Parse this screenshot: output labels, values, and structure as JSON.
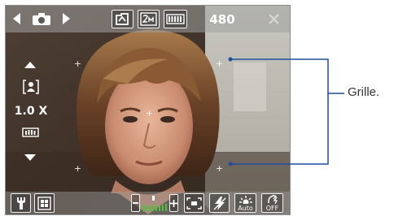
{
  "camera": {
    "shots_remaining": "480",
    "zoom_label": "1.0 X",
    "whitebalance_label": "Auto",
    "flash_label": "OFF"
  },
  "callout": {
    "label": "Grille."
  },
  "colors": {
    "callout_line": "#1f4e9c",
    "toolbar_glass": "#a0a0a0",
    "icon": "#ffffff",
    "level_bar": "#4fc23a"
  }
}
